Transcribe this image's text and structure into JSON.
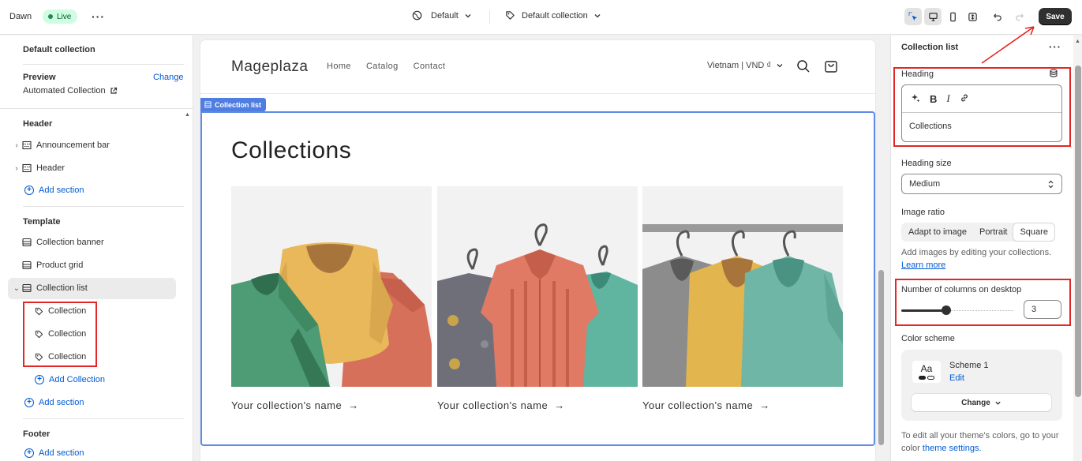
{
  "topbar": {
    "theme_name": "Dawn",
    "status": "Live",
    "template_select": "Default",
    "page_select": "Default collection",
    "save_label": "Save"
  },
  "left": {
    "title": "Default collection",
    "preview_label": "Preview",
    "preview_change": "Change",
    "preview_value": "Automated Collection",
    "header_group": "Header",
    "header_items": [
      "Announcement bar",
      "Header"
    ],
    "add_section": "Add section",
    "template_group": "Template",
    "template_items": [
      "Collection banner",
      "Product grid",
      "Collection list"
    ],
    "collection_blocks": [
      "Collection",
      "Collection",
      "Collection"
    ],
    "add_collection": "Add Collection",
    "footer_group": "Footer"
  },
  "preview": {
    "logo": "Mageplaza",
    "nav": [
      "Home",
      "Catalog",
      "Contact"
    ],
    "currency": "Vietnam | VND ₫",
    "section_tag": "Collection list",
    "heading": "Collections",
    "card_titles": [
      "Your collection's name",
      "Your collection's name",
      "Your collection's name"
    ],
    "arrow": "→"
  },
  "right": {
    "title": "Collection list",
    "heading_label": "Heading",
    "heading_value": "Collections",
    "heading_size_label": "Heading size",
    "heading_size_value": "Medium",
    "image_ratio_label": "Image ratio",
    "image_ratio_options": [
      "Adapt to image",
      "Portrait",
      "Square"
    ],
    "image_ratio_selected": "Square",
    "help_text": "Add images by editing your collections.",
    "learn_more": "Learn more",
    "columns_label": "Number of columns on desktop",
    "columns_value": "3",
    "columns_min": 1,
    "columns_max": 6,
    "color_scheme_label": "Color scheme",
    "scheme_preview": "Aa",
    "scheme_name": "Scheme 1",
    "scheme_edit": "Edit",
    "scheme_change": "Change",
    "footer_text": "To edit all your theme's colors, go to your color",
    "footer_link": "theme settings."
  },
  "colors": {
    "accent": "#005bd3",
    "highlight": "#e32626",
    "section_outline": "#5f8ae6"
  }
}
